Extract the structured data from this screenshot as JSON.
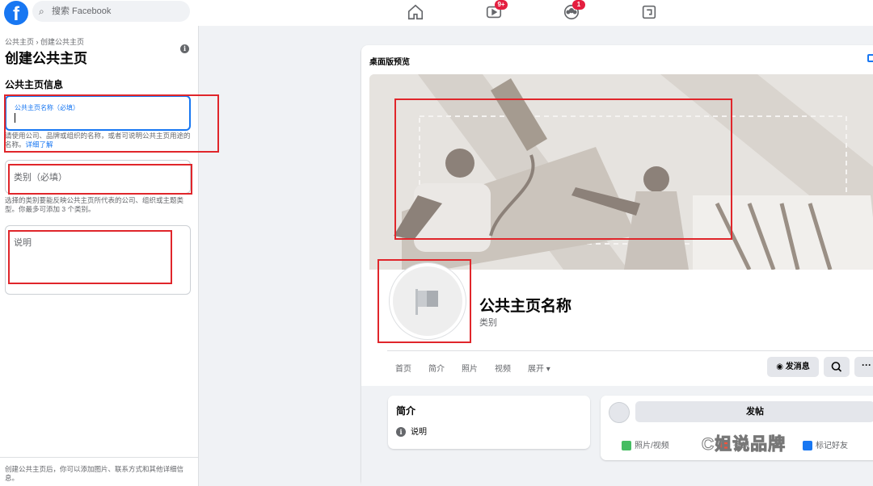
{
  "topbar": {
    "search_placeholder": "搜索 Facebook",
    "nav": [
      {
        "name": "home",
        "badge": ""
      },
      {
        "name": "watch",
        "badge": "9+"
      },
      {
        "name": "groups",
        "badge": "1"
      },
      {
        "name": "gaming",
        "badge": ""
      }
    ]
  },
  "left": {
    "breadcrumb": "公共主页 › 创建公共主页",
    "title": "创建公共主页",
    "section_title": "公共主页信息",
    "name_label": "公共主页名称（必填）",
    "name_help": "请使用公司、品牌或组织的名称，或者可说明公共主页用途的名称。",
    "name_help_link": "详细了解",
    "category_placeholder": "类别（必填）",
    "category_help": "选择的类别要能反映公共主页所代表的公司、组织或主题类型。你最多可添加 3 个类别。",
    "description_placeholder": "说明",
    "bottom_note": "创建公共主页后，你可以添加图片、联系方式和其他详细信息。"
  },
  "preview": {
    "title": "桌面版预览",
    "page_name": "公共主页名称",
    "page_category": "类别",
    "tabs": [
      "首页",
      "简介",
      "照片",
      "视频",
      "展开 ▾"
    ],
    "message_button": "发消息",
    "more_button": "···",
    "intro_title": "简介",
    "intro_row": "说明",
    "post_button": "发帖",
    "post_options": [
      "照片/视频",
      "签到",
      "标记好友"
    ]
  },
  "watermark": "C姐说品牌",
  "colors": {
    "brand": "#1877f2",
    "annotation": "#e0262b",
    "badge": "#e41e3f"
  }
}
